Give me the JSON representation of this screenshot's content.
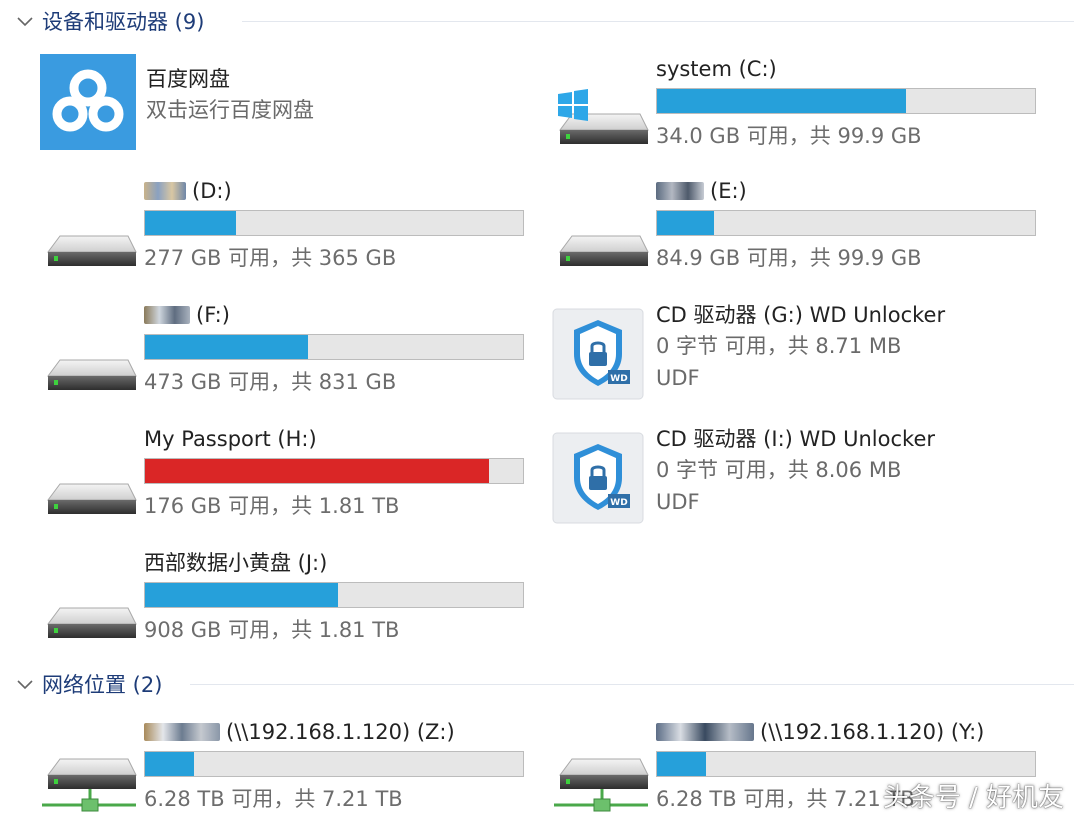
{
  "groups": [
    {
      "title": "设备和驱动器 (9)"
    },
    {
      "title": "网络位置 (2)"
    }
  ],
  "app": {
    "name": "百度网盘",
    "desc": "双击运行百度网盘",
    "icon": "baidu-netdisk-cloud-icon",
    "color": "#3a9be0"
  },
  "drives": [
    {
      "label": "system (C:)",
      "free_fraction": 0.66,
      "capacity": "34.0 GB 可用，共 99.9 GB",
      "icon": "windows-drive-icon"
    },
    {
      "label": "(D:)",
      "free_fraction": 0.24,
      "capacity": "277 GB 可用，共 365 GB",
      "icon": "drive-icon"
    },
    {
      "label": "(E:)",
      "free_fraction": 0.15,
      "capacity": "84.9 GB 可用，共 99.9 GB",
      "icon": "drive-icon"
    },
    {
      "label": "(F:)",
      "free_fraction": 0.43,
      "capacity": "473 GB 可用，共 831 GB",
      "icon": "drive-icon"
    },
    {
      "label": "My Passport (H:)",
      "free_fraction": 0.91,
      "capacity": "176 GB 可用，共 1.81 TB",
      "icon": "drive-icon",
      "bar_color": "#da2626"
    },
    {
      "label": "西部数据小黄盘 (J:)",
      "free_fraction": 0.51,
      "capacity": "908 GB 可用，共 1.81 TB",
      "icon": "drive-icon"
    }
  ],
  "cd_drives": [
    {
      "label": "CD 驱动器 (G:) WD Unlocker",
      "capacity": "0 字节 可用，共 8.71 MB",
      "fs": "UDF",
      "icon": "wd-unlocker-shield-icon"
    },
    {
      "label": "CD 驱动器 (I:) WD Unlocker",
      "capacity": "0 字节 可用，共 8.06 MB",
      "fs": "UDF",
      "icon": "wd-unlocker-shield-icon"
    }
  ],
  "network": [
    {
      "label": "(\\\\192.168.1.120) (Z:)",
      "free_fraction": 0.13,
      "capacity": "6.28 TB 可用，共 7.21 TB",
      "icon": "network-drive-icon"
    },
    {
      "label": "(\\\\192.168.1.120) (Y:)",
      "free_fraction": 0.13,
      "capacity": "6.28 TB 可用，共 7.21 TB",
      "icon": "network-drive-icon"
    }
  ],
  "watermark": "头条号 / 好机友",
  "colors": {
    "bar_fill": "#26a0da",
    "bar_full": "#da2626",
    "header": "#1e3c78"
  }
}
